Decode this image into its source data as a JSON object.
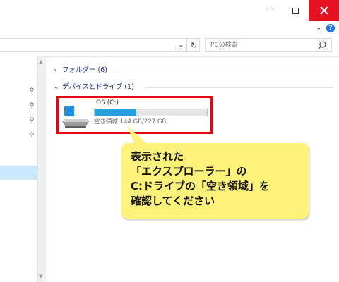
{
  "window": {
    "buttons": [
      "minimize",
      "maximize",
      "close"
    ]
  },
  "ribbon": {
    "expand_icon": "chevron-down-icon",
    "help_icon": "help-icon",
    "help_label": "?"
  },
  "address": {
    "dropdown_icon": "chevron-down-icon",
    "refresh_icon": "refresh-icon",
    "search_placeholder": "PCの検索",
    "search_icon": "search-icon"
  },
  "nav": {
    "pin_icon": "pin-icon",
    "selected_color": "#cce8ff"
  },
  "content": {
    "groups": [
      {
        "label": "フォルダー (6)",
        "expanded": false
      },
      {
        "label": "デバイスとドライブ (1)",
        "expanded": true
      }
    ],
    "drive": {
      "name": "OS (C:)",
      "space_text": "空き領域 144 GB/227 GB",
      "used_fraction": 0.37,
      "bar_color": "#26a0da"
    }
  },
  "callout": {
    "lines": [
      "表示された",
      "「エクスプローラー」の",
      "C:ドライブの「空き領域」を",
      "確認してください"
    ],
    "background": "#fff27a",
    "highlight_color": "#e60012"
  }
}
